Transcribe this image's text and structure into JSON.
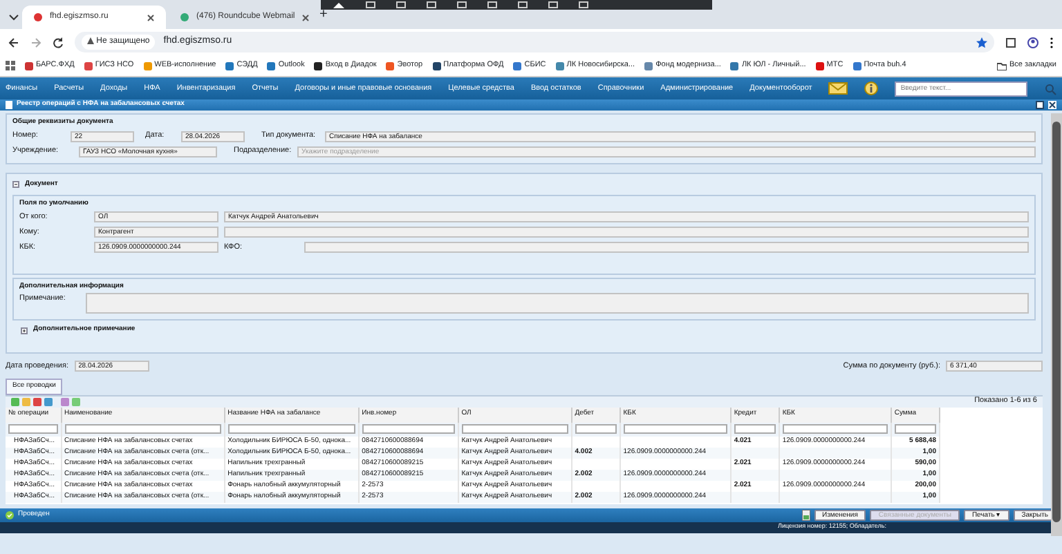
{
  "browser": {
    "tabs": [
      {
        "title": "fhd.egiszmso.ru",
        "selected": true
      },
      {
        "title": "(476) Roundcube Webmail",
        "selected": false
      }
    ],
    "new_tab": "+",
    "security": "Не защищено",
    "url": "fhd.egiszmso.ru",
    "bookmarks": [
      "БАРС.ФХД",
      "ГИСЗ НСО",
      "WEB-исполнение",
      "СЭДД",
      "Outlook",
      "Вход в Диадок",
      "Эвотор",
      "Платформа ОФД",
      "СБИС",
      "ЛК Новосибирска...",
      "Фонд модерниза...",
      "ЛК ЮЛ - Личный...",
      "МТС",
      "Почта buh.4"
    ],
    "all_bookmarks": "Все закладки"
  },
  "menu": {
    "items": [
      "Финансы",
      "Расчеты",
      "Доходы",
      "НФА",
      "Инвентаризация",
      "Отчеты",
      "Договоры и иные правовые основания",
      "Целевые средства",
      "Ввод остатков",
      "Справочники",
      "Администрирование",
      "Документооборот"
    ],
    "search_placeholder": "Введите текст..."
  },
  "window": {
    "title": "Реестр операций с НФА на забалансовых счетах"
  },
  "general": {
    "legend": "Общие реквизиты документа",
    "number": {
      "label": "Номер:",
      "value": "22"
    },
    "date": {
      "label": "Дата:",
      "value": "28.04.2026"
    },
    "doc_type": {
      "label": "Тип документа:",
      "value": "Списание НФА на забалансе"
    },
    "institution": {
      "label": "Учреждение:",
      "value": "ГАУЗ НСО «Молочная кухня»"
    },
    "department": {
      "label": "Подразделение:",
      "placeholder": "Укажите подразделение"
    }
  },
  "document": {
    "legend": "Документ",
    "expanded": true,
    "sublegend": "Поля по умолчанию",
    "from": {
      "label": "От кого:",
      "value": "ОЛ",
      "value2": "Катчук Андрей Анатольевич"
    },
    "to": {
      "label": "Кому:",
      "value": "Контрагент"
    },
    "kbk": {
      "label": "КБК:",
      "value": "126.0909.0000000000.244"
    },
    "kfo": {
      "label": "КФО:"
    }
  },
  "extra": {
    "legend": "Дополнительная информация",
    "note_label": "Примечание:"
  },
  "extra_note": {
    "legend": "Дополнительное примечание",
    "expanded": false
  },
  "posting_date": {
    "label": "Дата проведения:",
    "value": "28.04.2026"
  },
  "total": {
    "label": "Сумма по документу (руб.):",
    "value": "6 371,40"
  },
  "grid": {
    "tab": "Все проводки",
    "shown": "Показано 1-6 из 6",
    "columns": [
      "№ операции",
      "Наименование",
      "Название НФА на забалансе",
      "Инв.номер",
      "ОЛ",
      "Дебет",
      "КБК",
      "Кредит",
      "КБК",
      "Сумма"
    ],
    "rows": [
      [
        "НФАЗабСч...",
        "Списание НФА на забалансовых счетах",
        "Холодильник БИРЮСА Б-50, однока...",
        "0842710600088694",
        "Катчук Андрей Анатольевич",
        "",
        "",
        "4.021",
        "126.0909.0000000000.244",
        "5 688,48"
      ],
      [
        "НФАЗабСч...",
        "Списание НФА на забалансовых счета (отк...",
        "Холодильник БИРЮСА Б-50, однока...",
        "0842710600088694",
        "Катчук Андрей Анатольевич",
        "4.002",
        "126.0909.0000000000.244",
        "",
        "",
        "1,00"
      ],
      [
        "НФАЗабСч...",
        "Списание НФА на забалансовых счетах",
        "Напильник трехгранный",
        "0842710600089215",
        "Катчук Андрей Анатольевич",
        "",
        "",
        "2.021",
        "126.0909.0000000000.244",
        "590,00"
      ],
      [
        "НФАЗабСч...",
        "Списание НФА на забалансовых счета (отк...",
        "Напильник трехгранный",
        "0842710600089215",
        "Катчук Андрей Анатольевич",
        "2.002",
        "126.0909.0000000000.244",
        "",
        "",
        "1,00"
      ],
      [
        "НФАЗабСч...",
        "Списание НФА на забалансовых счетах",
        "Фонарь налобный аккумуляторный",
        "2-2573",
        "Катчук Андрей Анатольевич",
        "",
        "",
        "2.021",
        "126.0909.0000000000.244",
        "200,00"
      ],
      [
        "НФАЗабСч...",
        "Списание НФА на забалансовых счета (отк...",
        "Фонарь налобный аккумуляторный",
        "2-2573",
        "Катчук Андрей Анатольевич",
        "2.002",
        "126.0909.0000000000.244",
        "",
        "",
        "1,00"
      ]
    ]
  },
  "status": {
    "state": "Проведен",
    "buttons": [
      {
        "label": "Изменения",
        "disabled": false
      },
      {
        "label": "Связанные документы",
        "disabled": true
      },
      {
        "label": "Печать ▾",
        "disabled": false
      },
      {
        "label": "Закрыть",
        "disabled": false
      }
    ]
  },
  "taskbar": {
    "license": "Лицензия номер: 12155; Обладатель:"
  }
}
